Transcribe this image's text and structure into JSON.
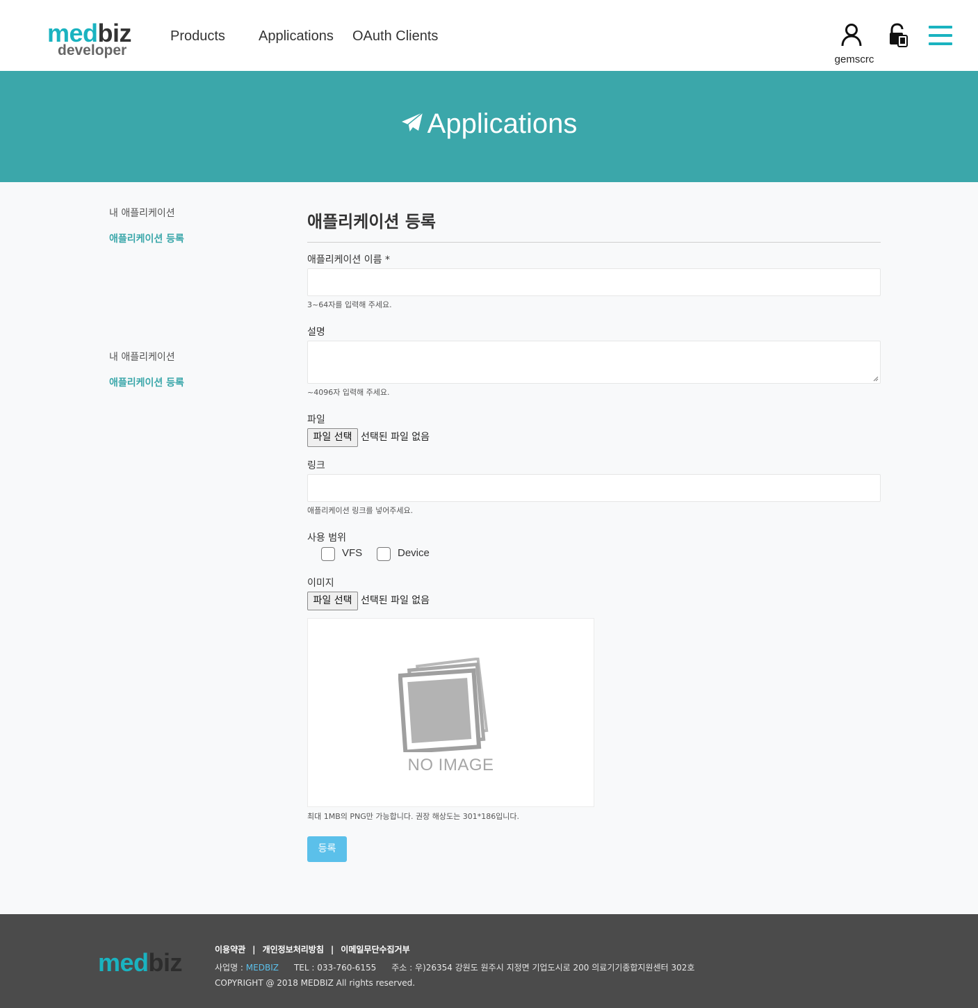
{
  "header": {
    "logo_brand_part1": "med",
    "logo_brand_part2": "biz",
    "logo_sub": "developer",
    "nav": [
      "Products",
      "Applications",
      "OAuth Clients"
    ],
    "username": "gemscrc"
  },
  "banner": {
    "title": "Applications",
    "icon": "paper-plane-icon"
  },
  "sidebar": {
    "groups": [
      {
        "items": [
          "내 애플리케이션",
          "애플리케이션 등록"
        ]
      },
      {
        "items": [
          "내 애플리케이션",
          "애플리케이션 등록"
        ]
      }
    ],
    "active_item": "애플리케이션 등록"
  },
  "form": {
    "title": "애플리케이션 등록",
    "name_label": "애플리케이션 이름 *",
    "name_value": "",
    "name_help": "3~64자를 입력해 주세요.",
    "desc_label": "설명",
    "desc_value": "",
    "desc_help": "~4096자 입력해 주세요.",
    "file_label": "파일",
    "file_button": "파일 선택",
    "file_status": "선택된 파일 없음",
    "link_label": "링크",
    "link_value": "",
    "link_help": "애플리케이션 링크를 넣어주세요.",
    "scope_label": "사용 범위",
    "scope_options": [
      {
        "label": "VFS",
        "checked": false
      },
      {
        "label": "Device",
        "checked": false
      }
    ],
    "image_label": "이미지",
    "image_button": "파일 선택",
    "image_status": "선택된 파일 없음",
    "image_placeholder": "NO IMAGE",
    "image_help": "최대 1MB의 PNG만 가능합니다. 권장 해상도는 301*186입니다.",
    "submit": "등록"
  },
  "footer": {
    "logo_part1": "med",
    "logo_part2": "biz",
    "links": [
      "이용약관",
      "개인정보처리방침",
      "이메일무단수집거부"
    ],
    "company_label": "사업명 : ",
    "company_name": "MEDBIZ",
    "tel": "TEL : 033-760-6155",
    "address": "주소 : 우)26354 강원도 원주시 지정면 기업도시로 200 의료기기종합지원센터 302호",
    "copyright": "COPYRIGHT @ 2018 MEDBIZ All rights reserved."
  },
  "colors": {
    "accent": "#1ab3c0",
    "banner": "#3ba7aa",
    "button": "#5bc0ea",
    "footer": "#4b4b4b"
  }
}
